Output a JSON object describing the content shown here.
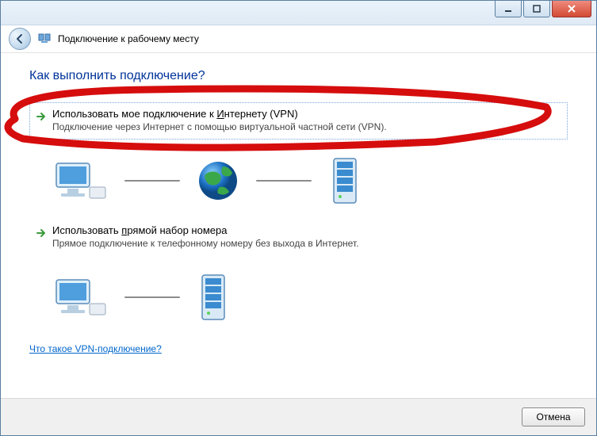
{
  "window": {
    "title": "Подключение к рабочему месту"
  },
  "heading": "Как выполнить подключение?",
  "options": [
    {
      "title_pre": "Использовать мое подключение к ",
      "title_ul": "И",
      "title_post": "нтернету (VPN)",
      "desc": "Подключение через Интернет с помощью виртуальной частной сети (VPN)."
    },
    {
      "title_pre": "Использовать ",
      "title_ul": "п",
      "title_post": "рямой набор номера",
      "desc": "Прямое подключение к телефонному номеру без выхода в Интернет."
    }
  ],
  "help_link": "Что такое VPN-подключение?",
  "cancel_label": "Отмена"
}
